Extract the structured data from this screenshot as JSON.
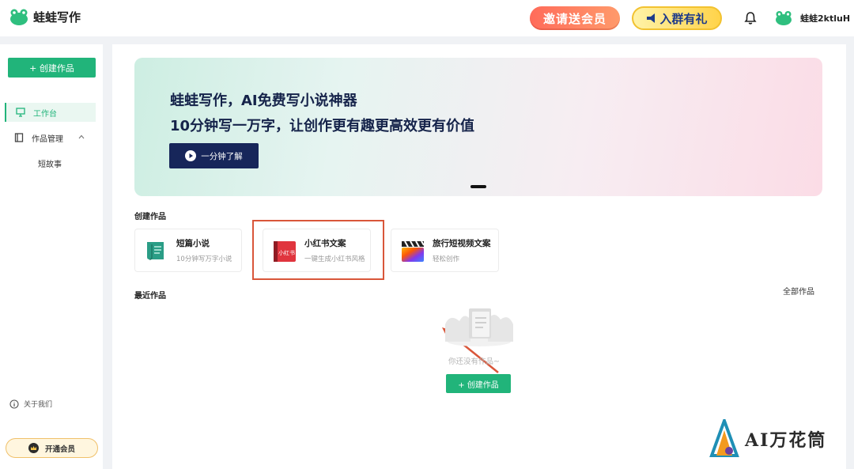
{
  "header": {
    "app_name": "蛙蛙写作",
    "invite_label": "邀请送会员",
    "group_label": "入群有礼",
    "username": "蛙蛙2ktluH"
  },
  "sidebar": {
    "create_label": "+ 创建作品",
    "items": [
      {
        "label": "工作台",
        "icon": "monitor-icon",
        "active": true
      },
      {
        "label": "作品管理",
        "icon": "book-icon",
        "expanded": true
      },
      {
        "label": "短故事"
      }
    ],
    "about_label": "关于我们",
    "vip_label": "开通会员"
  },
  "banner": {
    "title": "蛙蛙写作，AI免费写小说神器",
    "subtitle": "10分钟写一万字，让创作更有趣更高效更有价值",
    "button_label": "一分钟了解"
  },
  "create_section": {
    "label": "创建作品",
    "cards": [
      {
        "title": "短篇小说",
        "desc": "10分钟写万字小说",
        "icon": "scroll-icon"
      },
      {
        "title": "小红书文案",
        "desc": "一键生成小红书风格",
        "icon": "xiaohongshu-icon"
      },
      {
        "title": "旅行短视频文案",
        "desc": "轻松创作",
        "icon": "clapperboard-icon"
      }
    ]
  },
  "recent_section": {
    "label": "最近作品",
    "all_label": "全部作品",
    "empty_text": "你还没有作品~",
    "create_label": "+ 创建作品"
  },
  "watermark": {
    "text": "AI万花筒"
  },
  "colors": {
    "brand": "#21b47a",
    "banner_button": "#17265a",
    "highlight": "#d9563a"
  }
}
